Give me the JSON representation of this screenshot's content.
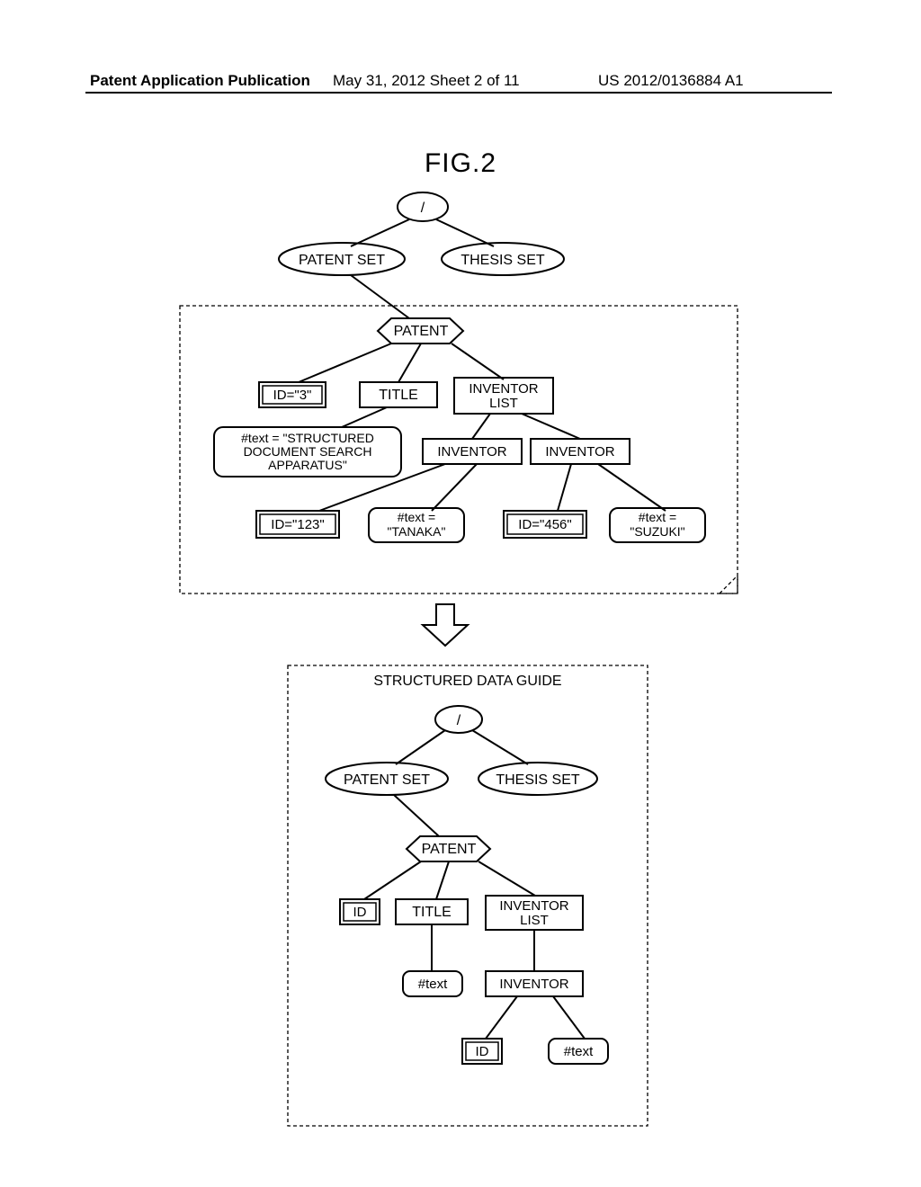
{
  "header": {
    "left": "Patent Application Publication",
    "mid": "May 31, 2012  Sheet 2 of 11",
    "right": "US 2012/0136884 A1"
  },
  "figureTitle": "FIG.2",
  "top": {
    "root": "/",
    "patentSet": "PATENT SET",
    "thesisSet": "THESIS SET",
    "patent": "PATENT",
    "id3": "ID=\"3\"",
    "title": "TITLE",
    "inventorList1": "INVENTOR",
    "inventorList2": "LIST",
    "textStruct1": "#text = \"STRUCTURED",
    "textStruct2": "DOCUMENT SEARCH",
    "textStruct3": "APPARATUS\"",
    "inventor": "INVENTOR",
    "id123": "ID=\"123\"",
    "textTanaka1": "#text =",
    "textTanaka2": "\"TANAKA\"",
    "id456": "ID=\"456\"",
    "textSuzuki1": "#text =",
    "textSuzuki2": "\"SUZUKI\""
  },
  "bottom": {
    "title": "STRUCTURED DATA GUIDE",
    "root": "/",
    "patentSet": "PATENT SET",
    "thesisSet": "THESIS SET",
    "patent": "PATENT",
    "id": "ID",
    "titleNode": "TITLE",
    "inventorList1": "INVENTOR",
    "inventorList2": "LIST",
    "text": "#text",
    "inventor": "INVENTOR",
    "id2": "ID",
    "text2": "#text"
  }
}
